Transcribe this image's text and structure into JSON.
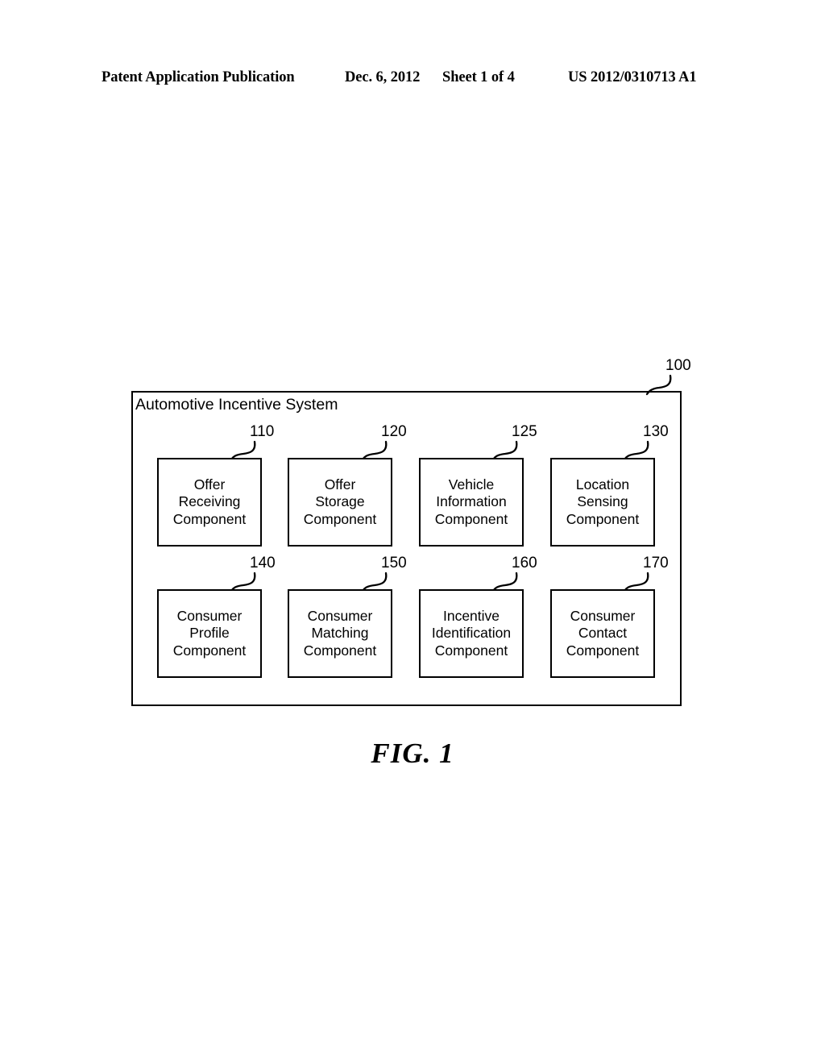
{
  "header": {
    "publication": "Patent Application Publication",
    "date": "Dec. 6, 2012",
    "sheet": "Sheet 1 of 4",
    "patent_number": "US 2012/0310713 A1"
  },
  "figure": {
    "caption": "FIG. 1",
    "system_ref": "100",
    "system_title": "Automotive Incentive System",
    "components": [
      {
        "ref": "110",
        "label": "Offer\nReceiving\nComponent"
      },
      {
        "ref": "120",
        "label": "Offer\nStorage\nComponent"
      },
      {
        "ref": "125",
        "label": "Vehicle\nInformation\nComponent"
      },
      {
        "ref": "130",
        "label": "Location\nSensing\nComponent"
      },
      {
        "ref": "140",
        "label": "Consumer\nProfile\nComponent"
      },
      {
        "ref": "150",
        "label": "Consumer\nMatching\nComponent"
      },
      {
        "ref": "160",
        "label": "Incentive\nIdentification\nComponent"
      },
      {
        "ref": "170",
        "label": "Consumer\nContact\nComponent"
      }
    ]
  },
  "colors": {
    "ink": "#000000",
    "paper": "#ffffff"
  }
}
